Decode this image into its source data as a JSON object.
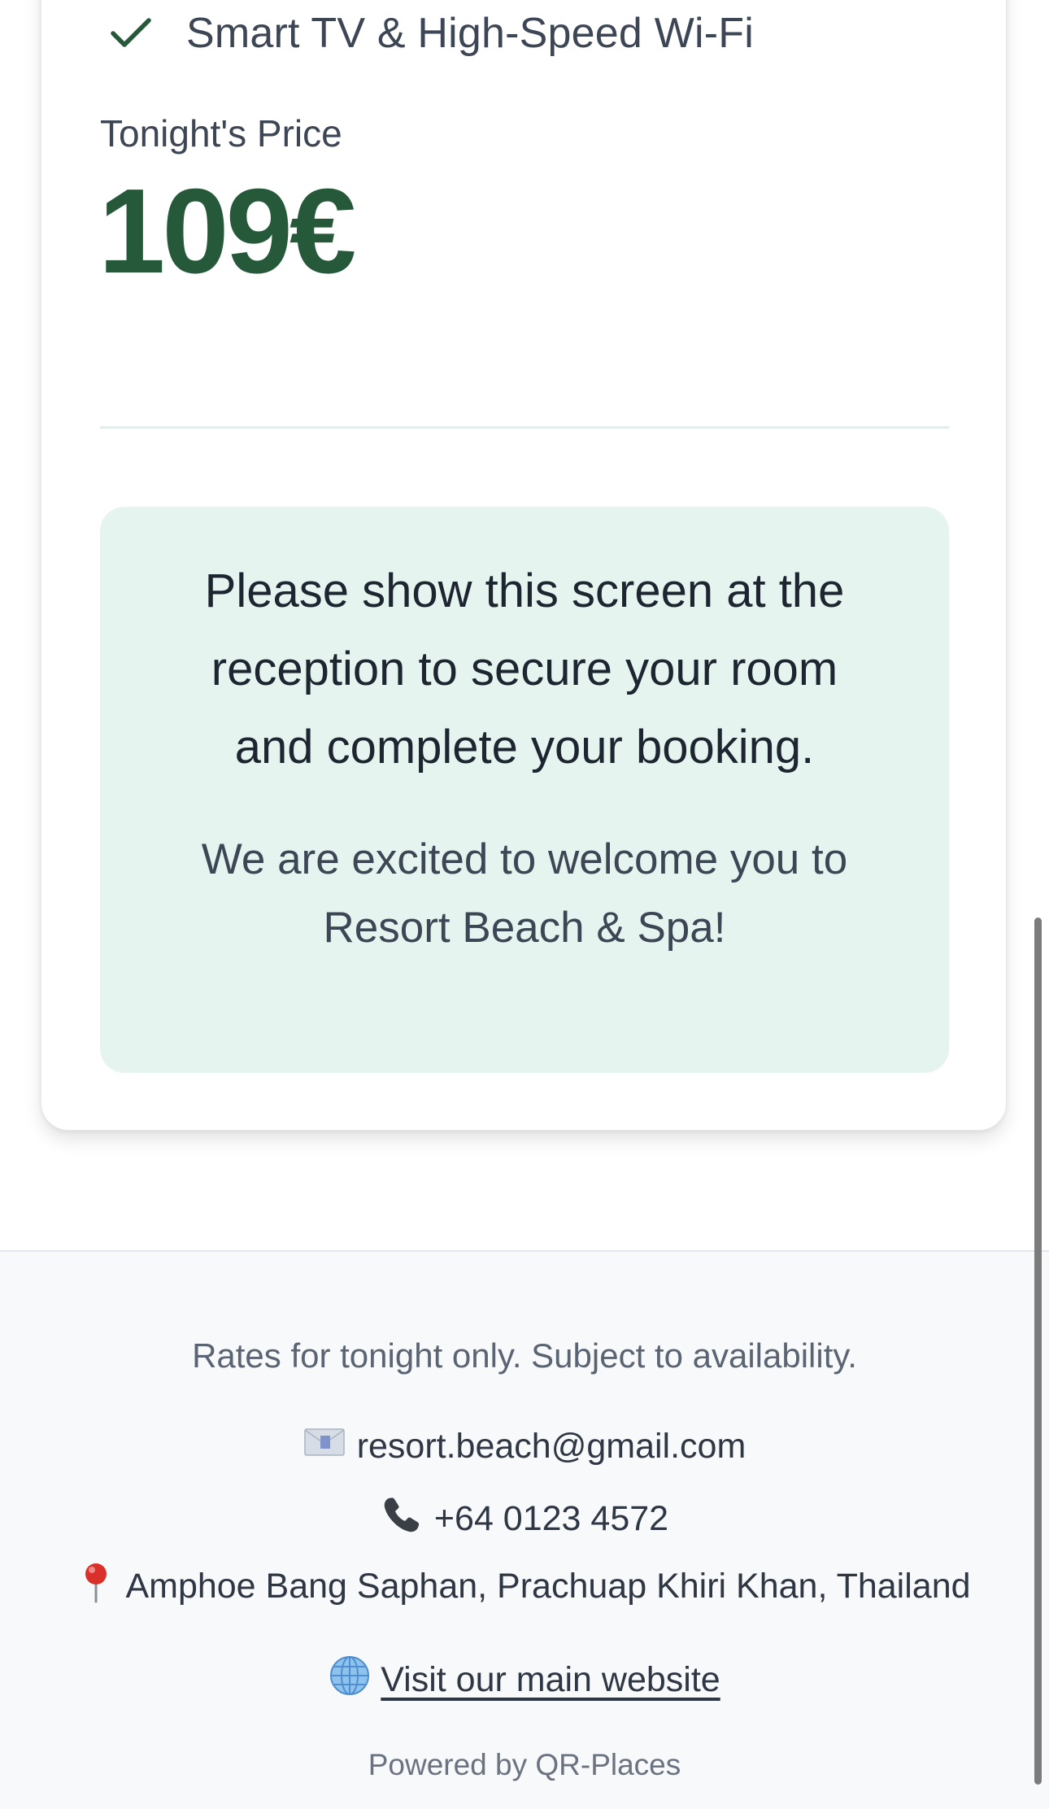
{
  "room": {
    "amenity_label": "Smart TV & High-Speed Wi-Fi",
    "price_label": "Tonight's Price",
    "price_value": "109€"
  },
  "notice": {
    "main_text": "Please show this screen at the reception to secure your room and complete your booking.",
    "sub_text": "We are excited to welcome you to Resort Beach & Spa!"
  },
  "footer": {
    "note": "Rates for tonight only. Subject to availability.",
    "email": "resort.beach@gmail.com",
    "phone": "+64 0123 4572",
    "address": "Amphoe Bang Saphan, Prachuap Khiri Khan, Thailand",
    "website_label": "Visit our main website",
    "powered_by": "Powered by QR-Places"
  },
  "icons": {
    "amenity": "check-icon",
    "email": "envelope-icon",
    "phone": "phone-icon",
    "address": "pin-icon",
    "website": "globe-icon"
  },
  "colors": {
    "price": "#25593a",
    "check": "#25593a",
    "notice_bg": "#e6f4ef"
  }
}
